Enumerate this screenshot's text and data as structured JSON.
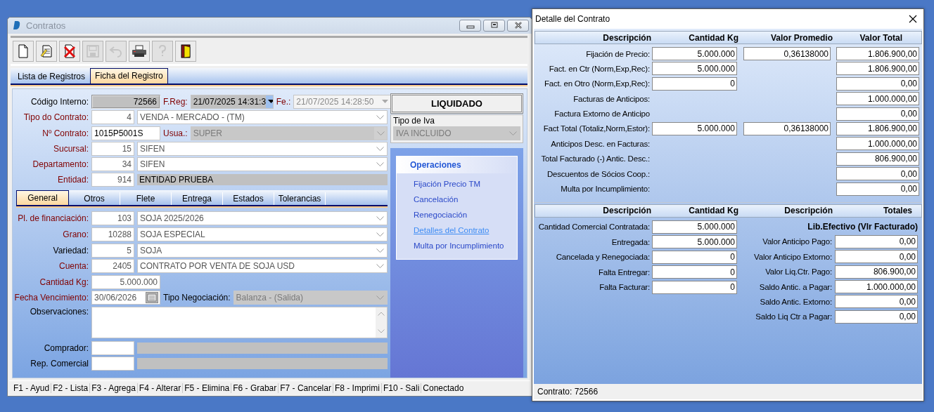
{
  "main_window": {
    "title": "Contratos"
  },
  "toolbar": [
    {
      "kind": "new",
      "disabled": false
    },
    {
      "kind": "edit",
      "disabled": false
    },
    {
      "kind": "delete",
      "disabled": false
    },
    {
      "kind": "save",
      "disabled": true
    },
    {
      "kind": "undo",
      "disabled": true
    },
    {
      "kind": "print",
      "disabled": false
    },
    {
      "kind": "help",
      "disabled": true
    },
    {
      "kind": "exit",
      "disabled": false
    }
  ],
  "tabs": [
    {
      "label": "Lista de Registros",
      "selected": false
    },
    {
      "label": "Ficha del Registro",
      "selected": true
    }
  ],
  "record_rows": [
    {
      "kind": "codigo",
      "label": "Código Interno:",
      "required": false,
      "value": "72566",
      "reg": {
        "label": "F.Reg:",
        "required": true,
        "value": "21/07/2025 14:31:3"
      },
      "fe": {
        "label": "Fe.:",
        "required": true,
        "value": "21/07/2025 14:28:50",
        "disabled": true
      }
    },
    {
      "kind": "code_combo",
      "label": "Tipo do Contrato:",
      "required": true,
      "code": "4",
      "value": "VENDA - MERCADO - (TM)"
    },
    {
      "kind": "contrato",
      "label": "Nº Contrato:",
      "required": true,
      "value": "1015P5001S",
      "user": {
        "label": "Usua.:",
        "required": true,
        "value": "SUPER",
        "disabled": true
      }
    },
    {
      "kind": "code_combo",
      "label": "Sucursal:",
      "required": true,
      "code": "15",
      "value": "SIFEN"
    },
    {
      "kind": "code_combo",
      "label": "Departamento:",
      "required": true,
      "code": "34",
      "value": "SIFEN"
    },
    {
      "kind": "code_text",
      "label": "Entidad:",
      "required": true,
      "code": "914",
      "value": "ENTIDAD PRUEBA"
    }
  ],
  "inner_tabs": [
    {
      "label": "General",
      "selected": true
    },
    {
      "label": "Otros",
      "selected": false
    },
    {
      "label": "Flete",
      "selected": false
    },
    {
      "label": "Entrega",
      "selected": false
    },
    {
      "label": "Estados",
      "selected": false
    },
    {
      "label": "Tolerancias",
      "selected": false
    }
  ],
  "general_rows": [
    {
      "kind": "code_combo",
      "label": "Pl. de financiación:",
      "required": true,
      "code": "103",
      "value": "SOJA 2025/2026"
    },
    {
      "kind": "code_combo",
      "label": "Grano:",
      "required": true,
      "code": "10288",
      "value": "SOJA ESPECIAL"
    },
    {
      "kind": "code_combo",
      "label": "Variedad:",
      "required": false,
      "code": "5",
      "value": "SOJA"
    },
    {
      "kind": "code_combo",
      "label": "Cuenta:",
      "required": true,
      "code": "2405",
      "value": "CONTRATO POR VENTA DE SOJA USD"
    },
    {
      "kind": "number",
      "label": "Cantidad Kg:",
      "required": true,
      "value": "5.000.000"
    },
    {
      "kind": "date",
      "label": "Fecha Vencimiento:",
      "required": true,
      "value": "30/06/2026",
      "negotiation": {
        "label": "Tipo Negociación:",
        "value": "Balanza - (Salida)",
        "disabled": true
      }
    },
    {
      "kind": "memo",
      "label": "Observaciones:",
      "required": false
    },
    {
      "kind": "code_text",
      "label": "Comprador:",
      "required": false
    },
    {
      "kind": "code_text",
      "label": "Rep. Comercial",
      "required": false
    }
  ],
  "status_badge": "LIQUIDADO",
  "iva": {
    "label": "Tipo de Iva",
    "value": "IVA INCLUIDO",
    "disabled": true
  },
  "operations": {
    "title": "Operaciones",
    "items": [
      {
        "label": "Fijación Precio TM",
        "selected": false
      },
      {
        "label": "Cancelación",
        "selected": false
      },
      {
        "label": "Renegociación",
        "selected": false
      },
      {
        "label": "Detalles del Contrato",
        "selected": true
      },
      {
        "label": "Multa por Incumplimiento",
        "selected": false
      }
    ]
  },
  "status_bar": [
    "F1 - Ayud",
    "F2 - Lista",
    "F3 - Agrega",
    "F4 - Alterar",
    "F5 - Elimina",
    "F6 - Grabar",
    "F7 - Cancelar",
    "F8 - Imprimi",
    "F10 - Sali",
    "Conectado"
  ],
  "detail_window": {
    "title": "Detalle del Contrato",
    "status": "Contrato: 72566"
  },
  "detail_columns": [
    "Descripción",
    "Cantidad Kg",
    "Valor Promedio",
    "Valor Total"
  ],
  "detail_rows": [
    {
      "label": "Fijación de Precio:",
      "quantity": "5.000.000",
      "average": "0,36138000",
      "total": "1.806.900,00"
    },
    {
      "label": "Fact. en Ctr (Norm,Exp,Rec):",
      "quantity": "5.000.000",
      "total": "1.806.900,00"
    },
    {
      "label": "Fact. en Otro (Norm,Exp,Rec):",
      "quantity": "0",
      "total": "0,00"
    },
    {
      "label": "Facturas de Anticipos:",
      "total": "1.000.000,00"
    },
    {
      "label": "Factura Extorno de Anticipo",
      "total": "0,00"
    },
    {
      "label": "Fact Total (Totaliz,Norm,Estor):",
      "quantity": "5.000.000",
      "average": "0,36138000",
      "total": "1.806.900,00"
    },
    {
      "label": "Anticipos Desc. en Facturas:",
      "total": "1.000.000,00"
    },
    {
      "label": "Total Facturado (-) Antic. Desc.:",
      "total": "806.900,00"
    },
    {
      "label": "Descuentos de Sócios Coop.:",
      "total": "0,00"
    },
    {
      "label": "Multa por Incumplimiento:",
      "total": "0,00"
    }
  ],
  "balance_columns": [
    "Descripción",
    "Cantidad Kg",
    "Descripción",
    "Totales"
  ],
  "quantity_rows": [
    {
      "label": "Cantidad Comercial Contratada:",
      "value": "5.000.000"
    },
    {
      "label": "Entregada:",
      "value": "5.000.000"
    },
    {
      "label": "Cancelada y Renegociada:",
      "value": "0"
    },
    {
      "label": "Falta Entregar:",
      "value": "0"
    },
    {
      "label": "Falta Facturar:",
      "value": "0"
    }
  ],
  "cash": {
    "title": "Lib.Efectivo (Vlr Facturado)",
    "rows": [
      {
        "label": "Valor Anticipo Pago:",
        "value": "0,00"
      },
      {
        "label": "Valor Anticipo Extorno:",
        "value": "0,00"
      },
      {
        "label": "Valor Liq.Ctr. Pago:",
        "value": "806.900,00"
      },
      {
        "label": "Saldo Antic. a Pagar:",
        "value": "1.000.000,00"
      },
      {
        "label": "Saldo Antic. Extorno:",
        "value": "0,00"
      },
      {
        "label": "Saldo Liq Ctr a Pagar:",
        "value": "0,00"
      }
    ]
  }
}
